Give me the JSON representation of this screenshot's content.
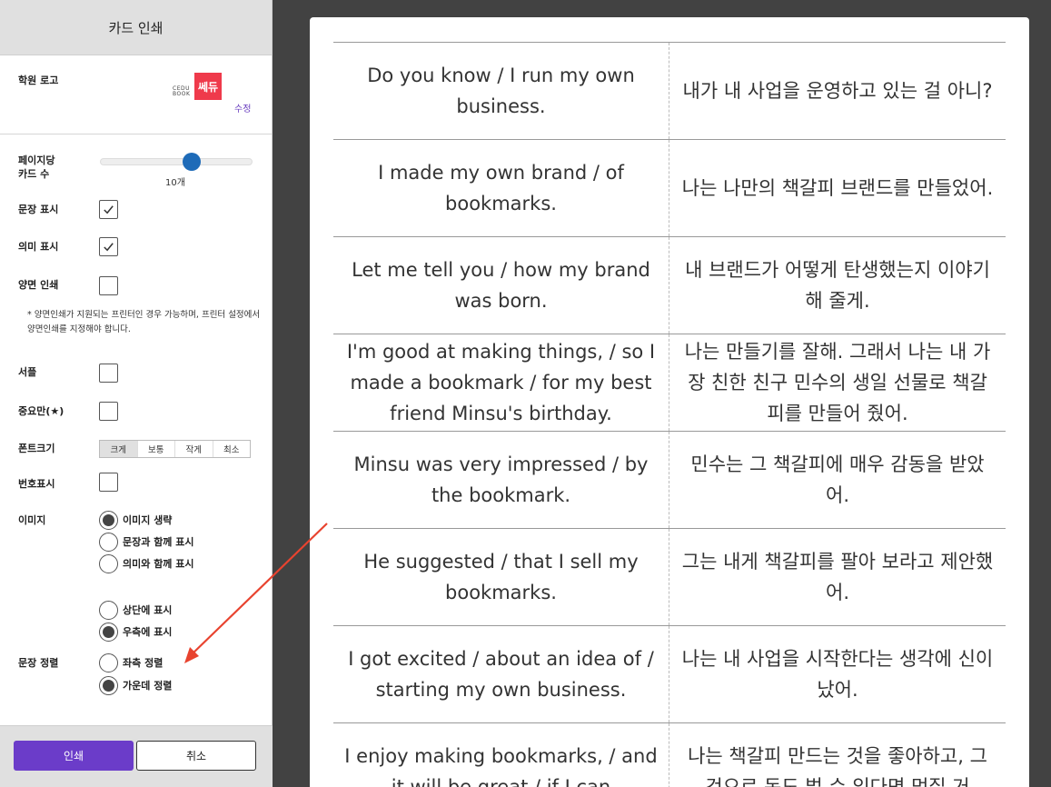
{
  "sidebar": {
    "title": "카드 인쇄",
    "logo": {
      "label": "학원 로고",
      "cedu_line1": "CEDU",
      "cedu_line2": "BOOK",
      "mark": "쎄듀",
      "edit": "수정"
    },
    "cards_per_page": {
      "label_line1": "페이지당",
      "label_line2": "카드 수",
      "value": "10개",
      "slider_fraction": 0.6
    },
    "options": {
      "sentence": {
        "label": "문장 표시",
        "checked": true
      },
      "meaning": {
        "label": "의미 표시",
        "checked": true
      },
      "duplex": {
        "label": "양면 인쇄",
        "checked": false
      },
      "duplex_note": "* 양면인쇄가 지원되는 프린터인 경우 가능하며, 프린터 설정에서 양면인쇄를 지정해야 합니다.",
      "sample": {
        "label": "서플",
        "checked": false
      },
      "important": {
        "label": "중요만(★)",
        "checked": false
      },
      "numbering": {
        "label": "번호표시",
        "checked": false
      }
    },
    "font_size": {
      "label": "폰트크기",
      "options": [
        "크게",
        "보통",
        "작게",
        "최소"
      ],
      "selected": "크게"
    },
    "image": {
      "label": "이미지",
      "mode_options": [
        "이미지 생략",
        "문장과 함께 표시",
        "의미와 함께 표시"
      ],
      "mode_selected": "이미지 생략",
      "position_options": [
        "상단에 표시",
        "우측에 표시"
      ],
      "position_selected": "우측에 표시"
    },
    "align": {
      "label": "문장 정렬",
      "options": [
        "좌측 정렬",
        "가운데 정렬"
      ],
      "selected": "가운데 정렬"
    },
    "buttons": {
      "print": "인쇄",
      "cancel": "취소"
    }
  },
  "cards": [
    {
      "en": "Do you know / I run my own business.",
      "ko": "내가 내 사업을 운영하고 있는 걸 아니?"
    },
    {
      "en": "I made my own brand / of bookmarks.",
      "ko": "나는 나만의 책갈피 브랜드를 만들었어."
    },
    {
      "en": "Let me tell you / how my brand was born.",
      "ko": "내 브랜드가 어떻게 탄생했는지 이야기 해 줄게."
    },
    {
      "en": "I'm good at making things, / so I made a bookmark / for my best friend Minsu's birthday.",
      "ko": "나는 만들기를 잘해. 그래서 나는 내 가장 친한 친구 민수의 생일 선물로 책갈피를 만들어 줬어."
    },
    {
      "en": "Minsu was very impressed / by the bookmark.",
      "ko": "민수는 그 책갈피에 매우 감동을 받았어."
    },
    {
      "en": "He suggested / that I sell my bookmarks.",
      "ko": "그는 내게 책갈피를 팔아 보라고 제안했어."
    },
    {
      "en": "I got excited / about an idea of / starting my own business.",
      "ko": "나는 내 사업을 시작한다는 생각에 신이 났어."
    },
    {
      "en": "I enjoy making bookmarks, / and it will be great / if I can",
      "ko": "나는 책갈피 만드는 것을 좋아하고, 그것으로 돈도 벌 수 있다면 멋질 거"
    }
  ]
}
